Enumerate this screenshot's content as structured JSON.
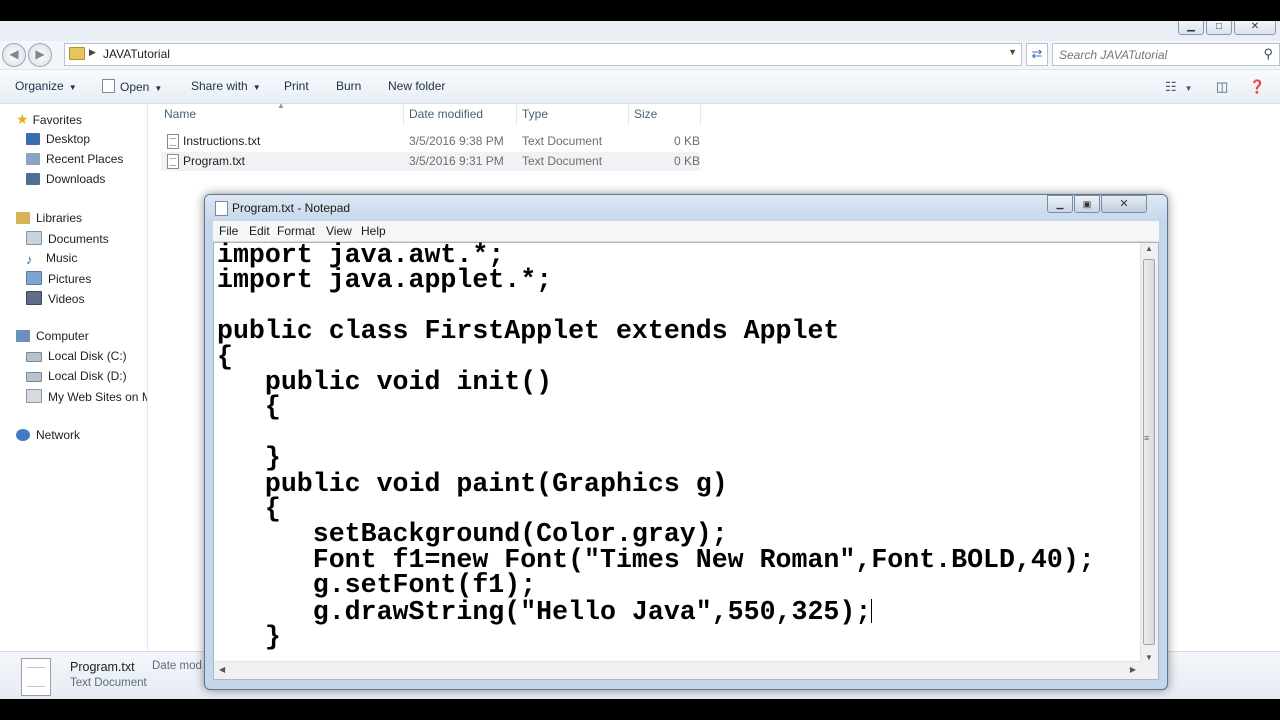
{
  "explorer": {
    "path": "JAVATutorial",
    "search_placeholder": "Search JAVATutorial",
    "toolbar": [
      "Organize",
      "Open",
      "Share with",
      "Print",
      "Burn",
      "New folder"
    ],
    "nav": {
      "favorites": "Favorites",
      "favorites_items": [
        "Desktop",
        "Recent Places",
        "Downloads"
      ],
      "libraries": "Libraries",
      "libraries_items": [
        "Documents",
        "Music",
        "Pictures",
        "Videos"
      ],
      "computer": "Computer",
      "computer_items": [
        "Local Disk (C:)",
        "Local Disk (D:)",
        "My Web Sites on MS"
      ],
      "network": "Network"
    },
    "columns": [
      "Name",
      "Date modified",
      "Type",
      "Size"
    ],
    "files": [
      {
        "name": "Instructions.txt",
        "date": "3/5/2016 9:38 PM",
        "type": "Text Document",
        "size": "0 KB"
      },
      {
        "name": "Program.txt",
        "date": "3/5/2016 9:31 PM",
        "type": "Text Document",
        "size": "0 KB"
      }
    ],
    "details": {
      "name": "Program.txt",
      "type": "Text Document",
      "date_label": "Date mod"
    }
  },
  "notepad": {
    "title": "Program.txt - Notepad",
    "menu": [
      "File",
      "Edit",
      "Format",
      "View",
      "Help"
    ],
    "code": "import java.awt.*;\nimport java.applet.*;\n\npublic class FirstApplet extends Applet\n{\n   public void init()\n   {\n\n   }\n   public void paint(Graphics g)\n   {\n      setBackground(Color.gray);\n      Font f1=new Font(\"Times New Roman\",Font.BOLD,40);\n      g.setFont(f1);\n      g.drawString(\"Hello Java\",550,325);",
    "code_end": "\n   }"
  },
  "colors": {
    "accent": "#3f6fb5",
    "folder": "#e8c45c",
    "nav_bg": "#ffffff"
  }
}
